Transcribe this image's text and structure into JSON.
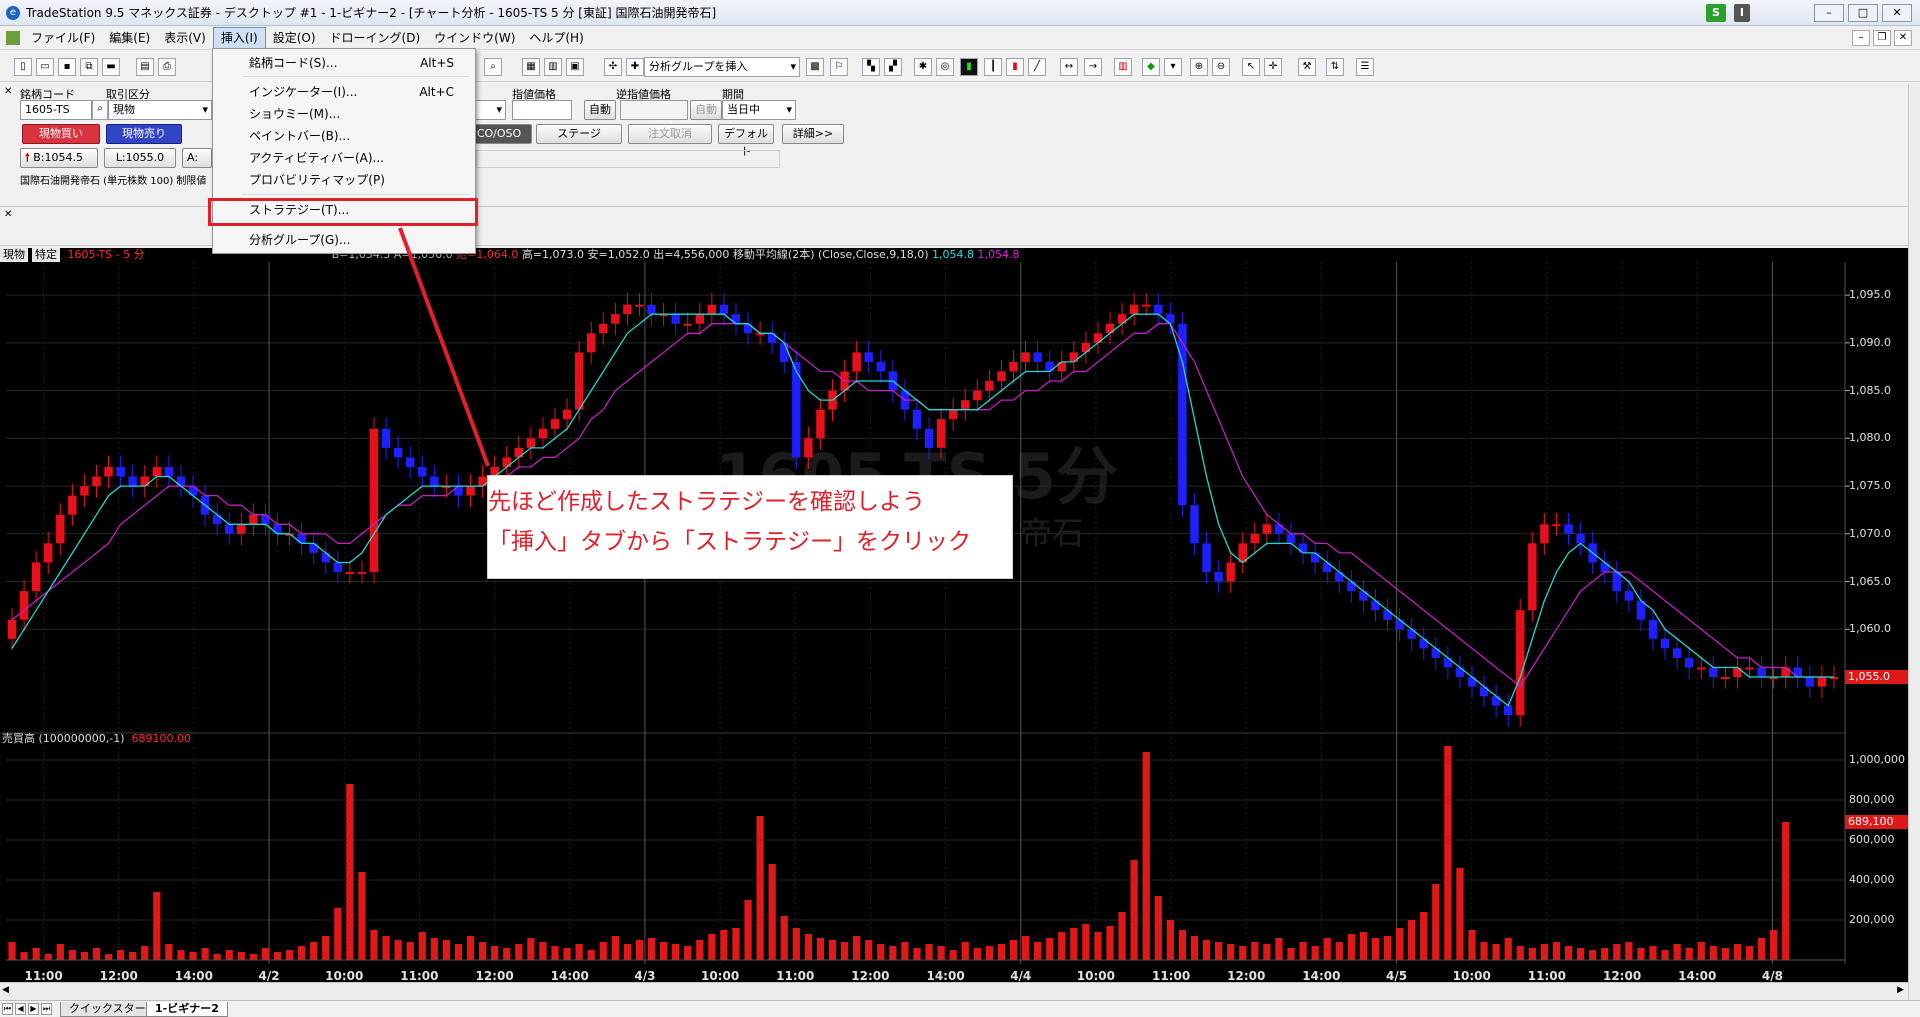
{
  "window": {
    "title": "TradeStation 9.5 マネックス証券 - デスクトップ #1 - 1-ビギナー2 - [チャート分析 - 1605-TS 5 分 [東証] 国際石油開発帝石]",
    "badge_s": "S",
    "badge_i": "I",
    "app_icon": "tradestation-logo-icon"
  },
  "menu": {
    "items": [
      "ファイル(F)",
      "編集(E)",
      "表示(V)",
      "挿入(I)",
      "設定(O)",
      "ドローイング(D)",
      "ウインドウ(W)",
      "ヘルプ(H)"
    ],
    "active_index": 3
  },
  "toolbar": {
    "analysis_group_select": "分析グループを挿入"
  },
  "order_panel": {
    "symbol_label": "銘柄コード",
    "symbol_value": "1605-TS",
    "trade_type_label": "取引区分",
    "trade_type_value": "現物",
    "limit_price_label": "指値価格",
    "auto_label": "自動",
    "stop_price_label": "逆指値価格",
    "auto_label_2": "自動",
    "period_label": "期間",
    "period_value": "当日中",
    "buy_button": "現物買い",
    "sell_button": "現物売り",
    "oco_button": "CO/OSO",
    "stage_button": "ステージ",
    "cancel_button": "注文取消",
    "default_button": "デフォルト",
    "detail_button": "詳細>>",
    "bid": "B:1054.5",
    "last": "L:1055.0",
    "ask": "A:",
    "company_line": "国際石油開発帝石 (単元株数 100) 制限値"
  },
  "insert_menu": {
    "items": [
      {
        "label": "銘柄コード(S)...",
        "shortcut": "Alt+S"
      },
      {
        "label": "インジケーター(I)...",
        "shortcut": "Alt+C"
      },
      {
        "label": "ショウミー(M)...",
        "shortcut": ""
      },
      {
        "label": "ペイントバー(B)...",
        "shortcut": ""
      },
      {
        "label": "アクティビティバー(A)...",
        "shortcut": ""
      },
      {
        "label": "プロバビリティマップ(P)",
        "shortcut": ""
      },
      {
        "label": "ストラテジー(T)...",
        "shortcut": ""
      },
      {
        "label": "分析グループ(G)...",
        "shortcut": ""
      }
    ]
  },
  "chart_header": {
    "left_select": "現物",
    "right_select": "特定",
    "symbol": "1605-TS - 5 分",
    "bid": "B=1,054.5",
    "ask": "A=1,056.0",
    "open": "始=1,064.0",
    "high_low_vol": "高=1,073.0 安=1,052.0 出=4,556,000",
    "indicator": "移動平均線(2本) (Close,Close,9,18,0)",
    "ma1_value": "1,054.8",
    "ma2_value": "1,054.8"
  },
  "watermark": {
    "line1": "1605-TS 5分",
    "line2": "帝石"
  },
  "volume_panel": {
    "label": "売買高 (100000000,-1)",
    "value": "689100.00",
    "current_label": "689,100"
  },
  "callout": {
    "line1": "先ほど作成したストラテジーを確認しよう",
    "line2": "「挿入」タブから「ストラテジー」をクリック"
  },
  "tabs": [
    "クイックスタート",
    "1-ビギナー2"
  ],
  "colors": {
    "up_bar": "#e8101a",
    "down_bar": "#2020ff",
    "ma_fast": "#20d8d0",
    "ma_slow": "#c020c0",
    "volume": "#e01818",
    "annotation": "#e0202a"
  },
  "chart_data": {
    "type": "candlestick",
    "price_ticks": [
      "1,095.0",
      "1,090.0",
      "1,085.0",
      "1,080.0",
      "1,075.0",
      "1,070.0",
      "1,065.0",
      "1,060.0"
    ],
    "price_range": [
      1050.5,
      1097
    ],
    "current_price": "1,055.0",
    "volume_ticks": [
      "1,000,000",
      "800,000",
      "600,000",
      "400,000",
      "200,000"
    ],
    "volume_range": [
      0,
      1060000
    ],
    "time_labels": [
      "11:00",
      "12:00",
      "14:00",
      "4/2",
      "10:00",
      "11:00",
      "12:00",
      "14:00",
      "4/3",
      "10:00",
      "11:00",
      "12:00",
      "14:00",
      "4/4",
      "10:00",
      "11:00",
      "12:00",
      "14:00",
      "4/5",
      "10:00",
      "11:00",
      "12:00",
      "14:00",
      "4/8"
    ],
    "closes": [
      1061,
      1064,
      1067,
      1069,
      1072,
      1074,
      1075,
      1076,
      1077,
      1076,
      1075,
      1076,
      1077,
      1076,
      1075,
      1074,
      1072,
      1071,
      1070,
      1071,
      1072,
      1071,
      1070,
      1070,
      1069,
      1068,
      1067,
      1066,
      1066,
      1066,
      1081,
      1079,
      1078,
      1077,
      1076,
      1075,
      1075,
      1074,
      1075,
      1076,
      1077,
      1078,
      1079,
      1080,
      1081,
      1082,
      1083,
      1089,
      1091,
      1092,
      1093,
      1094,
      1094,
      1093,
      1093,
      1092,
      1092,
      1093,
      1094,
      1093,
      1092,
      1091,
      1091,
      1090,
      1088,
      1078,
      1080,
      1083,
      1085,
      1087,
      1089,
      1088,
      1087,
      1085,
      1083,
      1081,
      1079,
      1082,
      1083,
      1084,
      1085,
      1086,
      1087,
      1088,
      1089,
      1088,
      1087,
      1088,
      1089,
      1090,
      1091,
      1092,
      1093,
      1094,
      1094,
      1093,
      1092,
      1073,
      1069,
      1066,
      1065,
      1067,
      1069,
      1070,
      1071,
      1070,
      1069,
      1068,
      1067,
      1066,
      1065,
      1064,
      1063,
      1062,
      1061,
      1060,
      1059,
      1058,
      1057,
      1056,
      1055,
      1054,
      1053,
      1052,
      1051,
      1062,
      1069,
      1071,
      1071,
      1070,
      1069,
      1067,
      1066,
      1064,
      1063,
      1061,
      1059,
      1058,
      1057,
      1056,
      1056,
      1055,
      1055,
      1056,
      1056,
      1055,
      1055,
      1056,
      1055,
      1054,
      1055,
      1055
    ],
    "ma_fast_values": [
      1058,
      1060,
      1062,
      1064,
      1066,
      1068,
      1070,
      1072,
      1074,
      1075,
      1075,
      1075,
      1076,
      1076,
      1075,
      1074,
      1073,
      1072,
      1071,
      1071,
      1071,
      1071,
      1070,
      1070,
      1069,
      1069,
      1068,
      1067,
      1067,
      1068,
      1070,
      1072,
      1073,
      1074,
      1075,
      1075,
      1075,
      1075,
      1075,
      1075,
      1076,
      1077,
      1078,
      1079,
      1079,
      1080,
      1081,
      1083,
      1085,
      1087,
      1089,
      1091,
      1092,
      1093,
      1093,
      1093,
      1093,
      1093,
      1093,
      1093,
      1092,
      1092,
      1091,
      1091,
      1090,
      1087,
      1085,
      1084,
      1084,
      1085,
      1086,
      1086,
      1086,
      1086,
      1085,
      1084,
      1083,
      1083,
      1083,
      1083,
      1083,
      1084,
      1085,
      1086,
      1087,
      1087,
      1087,
      1088,
      1088,
      1089,
      1090,
      1091,
      1092,
      1093,
      1093,
      1093,
      1092,
      1088,
      1082,
      1076,
      1071,
      1068,
      1067,
      1068,
      1069,
      1069,
      1069,
      1068,
      1068,
      1067,
      1066,
      1065,
      1064,
      1063,
      1062,
      1061,
      1060,
      1059,
      1058,
      1057,
      1056,
      1055,
      1054,
      1053,
      1052,
      1055,
      1059,
      1063,
      1066,
      1068,
      1069,
      1068,
      1067,
      1066,
      1065,
      1063,
      1062,
      1060,
      1059,
      1058,
      1057,
      1056,
      1056,
      1056,
      1055,
      1055,
      1055,
      1055,
      1055,
      1055,
      1055,
      1055
    ],
    "ma_slow_values": [
      1061,
      1062,
      1063,
      1064,
      1065,
      1066,
      1067,
      1068,
      1069,
      1071,
      1072,
      1073,
      1074,
      1075,
      1075,
      1075,
      1074,
      1074,
      1073,
      1073,
      1072,
      1072,
      1071,
      1071,
      1070,
      1070,
      1070,
      1069,
      1069,
      1070,
      1071,
      1072,
      1073,
      1073,
      1074,
      1074,
      1074,
      1075,
      1075,
      1075,
      1076,
      1076,
      1077,
      1077,
      1078,
      1078,
      1079,
      1080,
      1082,
      1083,
      1085,
      1086,
      1087,
      1088,
      1089,
      1090,
      1091,
      1091,
      1092,
      1092,
      1092,
      1092,
      1091,
      1091,
      1090,
      1089,
      1088,
      1087,
      1087,
      1086,
      1086,
      1085,
      1085,
      1085,
      1084,
      1084,
      1083,
      1083,
      1083,
      1083,
      1083,
      1083,
      1084,
      1084,
      1085,
      1085,
      1086,
      1086,
      1087,
      1087,
      1088,
      1089,
      1090,
      1091,
      1091,
      1092,
      1092,
      1090,
      1088,
      1085,
      1082,
      1079,
      1076,
      1074,
      1072,
      1071,
      1070,
      1070,
      1069,
      1069,
      1068,
      1068,
      1067,
      1066,
      1065,
      1064,
      1063,
      1062,
      1061,
      1060,
      1059,
      1058,
      1057,
      1056,
      1055,
      1054,
      1056,
      1058,
      1060,
      1062,
      1064,
      1065,
      1066,
      1066,
      1066,
      1065,
      1064,
      1063,
      1062,
      1061,
      1060,
      1059,
      1058,
      1057,
      1057,
      1056,
      1056,
      1056,
      1055,
      1055,
      1055,
      1055
    ],
    "volumes": [
      90000,
      40000,
      60000,
      30000,
      80000,
      50000,
      40000,
      60000,
      30000,
      50000,
      40000,
      70000,
      340000,
      80000,
      50000,
      40000,
      60000,
      30000,
      50000,
      40000,
      30000,
      60000,
      40000,
      50000,
      70000,
      90000,
      120000,
      260000,
      880000,
      440000,
      150000,
      120000,
      100000,
      90000,
      140000,
      110000,
      100000,
      80000,
      120000,
      90000,
      70000,
      60000,
      80000,
      110000,
      90000,
      70000,
      60000,
      80000,
      50000,
      90000,
      120000,
      80000,
      100000,
      110000,
      90000,
      80000,
      70000,
      100000,
      130000,
      150000,
      160000,
      300000,
      720000,
      480000,
      220000,
      160000,
      130000,
      110000,
      100000,
      90000,
      120000,
      100000,
      80000,
      70000,
      90000,
      60000,
      80000,
      70000,
      50000,
      90000,
      60000,
      70000,
      80000,
      100000,
      120000,
      90000,
      110000,
      140000,
      160000,
      180000,
      140000,
      170000,
      240000,
      500000,
      1040000,
      320000,
      200000,
      150000,
      120000,
      100000,
      90000,
      80000,
      70000,
      90000,
      80000,
      110000,
      60000,
      90000,
      70000,
      110000,
      90000,
      130000,
      140000,
      110000,
      120000,
      160000,
      200000,
      240000,
      380000,
      1070000,
      460000,
      150000,
      90000,
      80000,
      110000,
      70000,
      60000,
      80000,
      90000,
      70000,
      60000,
      50000,
      60000,
      80000,
      90000,
      60000,
      70000,
      50000,
      80000,
      60000,
      90000,
      70000,
      60000,
      80000,
      70000,
      110000,
      150000,
      690000
    ]
  }
}
